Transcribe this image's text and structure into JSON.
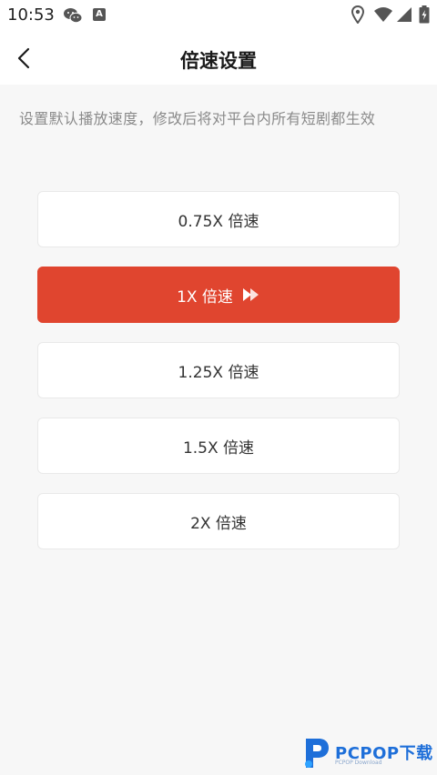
{
  "status_bar": {
    "time": "10:53",
    "icons": [
      "wechat-icon",
      "a-notification-icon",
      "location-icon",
      "wifi-icon",
      "signal-icon",
      "battery-icon"
    ],
    "a_badge": "A"
  },
  "header": {
    "title": "倍速设置",
    "back_icon": "chevron-left-icon"
  },
  "description": "设置默认播放速度，修改后将对平台内所有短剧都生效",
  "options": [
    {
      "label": "0.75X 倍速",
      "selected": false
    },
    {
      "label": "1X 倍速",
      "selected": true
    },
    {
      "label": "1.25X 倍速",
      "selected": false
    },
    {
      "label": "1.5X 倍速",
      "selected": false
    },
    {
      "label": "2X 倍速",
      "selected": false
    }
  ],
  "colors": {
    "accent": "#e0452f",
    "background": "#f7f7f7",
    "card": "#ffffff"
  },
  "watermark": {
    "text": "PCPOP下载",
    "sub": "PCPOP Download"
  }
}
